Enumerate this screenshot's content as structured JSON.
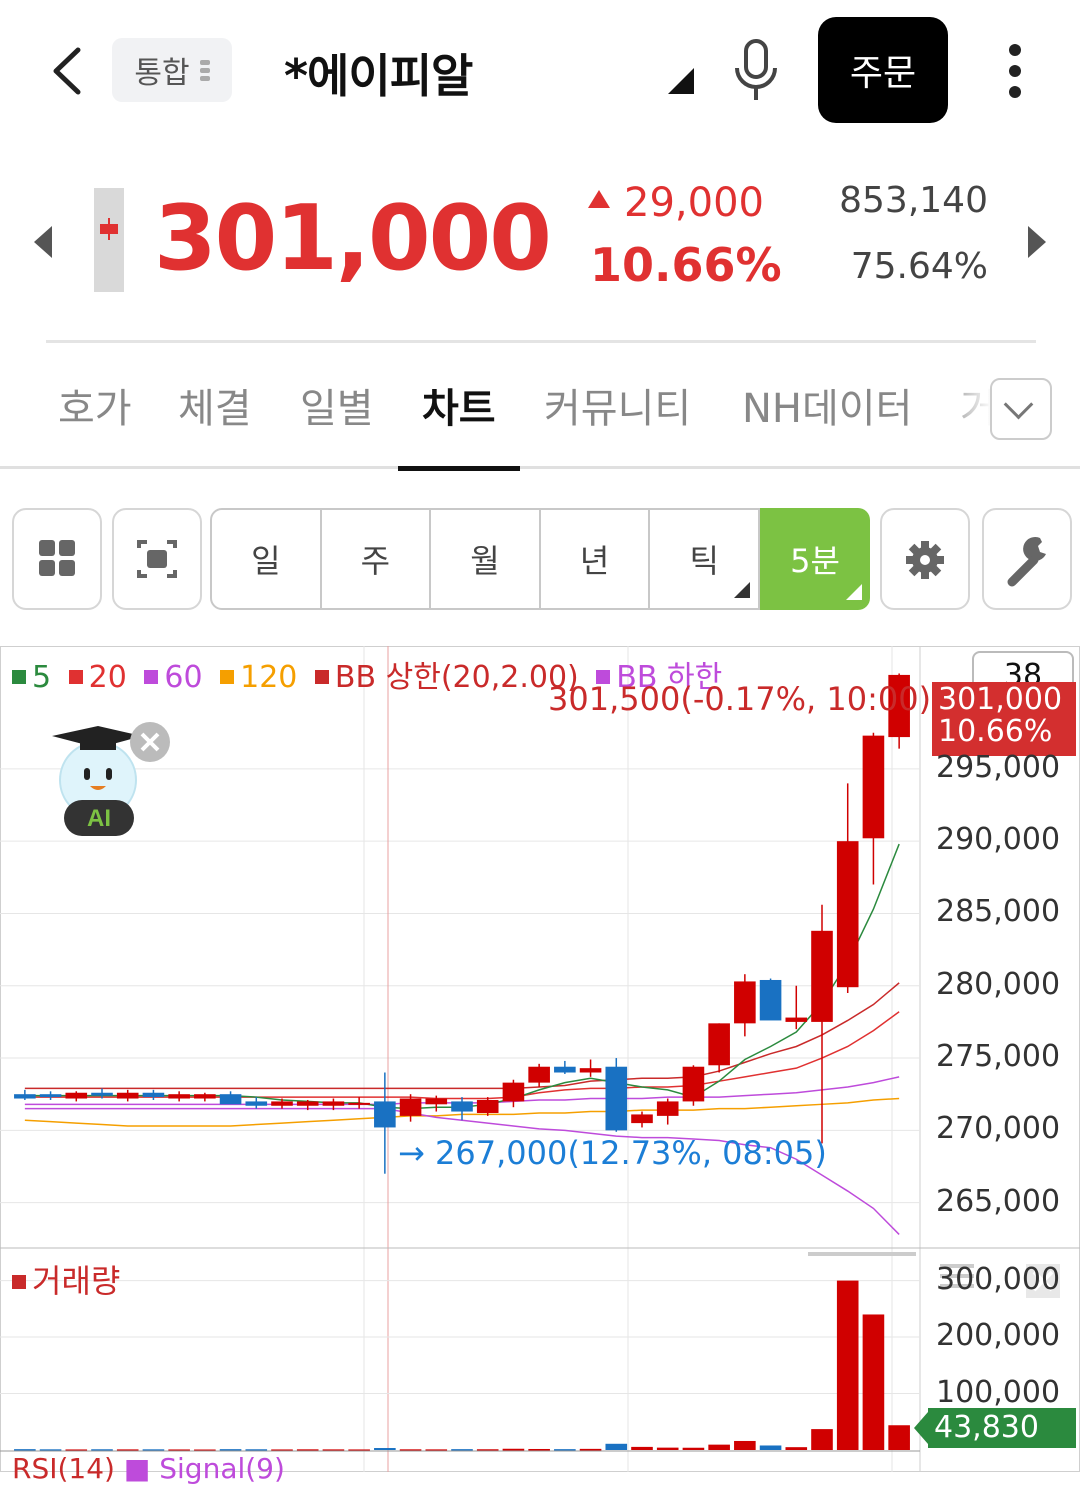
{
  "header": {
    "back_icon": "chevron-left-icon",
    "tag_label": "통합",
    "stock_name": "*에이피알",
    "mic_icon": "microphone-icon",
    "order_label": "주문",
    "more_icon": "kebab-menu-icon"
  },
  "quote": {
    "price": "301,000",
    "change": "29,000",
    "change_pct": "10.66%",
    "volume": "853,140",
    "volume_pct": "75.64%",
    "color_up": "#e03131"
  },
  "tabs": [
    {
      "label": "호가"
    },
    {
      "label": "체결"
    },
    {
      "label": "일별"
    },
    {
      "label": "차트"
    },
    {
      "label": "커뮤니티"
    },
    {
      "label": "NH데이터"
    },
    {
      "label": "거"
    }
  ],
  "active_tab": "차트",
  "toolbar": {
    "periods": [
      "일",
      "주",
      "월",
      "년",
      "틱"
    ],
    "active_period": "5분",
    "grid_icon": "grid-icon",
    "capture_icon": "capture-icon",
    "settings_icon": "gear-icon",
    "tools_icon": "wrench-icon",
    "accent": "#7cc243"
  },
  "chart": {
    "legend": [
      {
        "label": "5",
        "color": "#2b8a3e"
      },
      {
        "label": "20",
        "color": "#e03131"
      },
      {
        "label": "60",
        "color": "#be4bdb"
      },
      {
        "label": "120",
        "color": "#f59f00"
      },
      {
        "label": "BB 상한(20,2.00)",
        "color": "#c92a2a"
      },
      {
        "label": "BB 하한",
        "color": "#be4bdb"
      }
    ],
    "last_info": "301,500(-0.17%, 10:00)",
    "low_info": "267,000(12.73%, 08:05)",
    "count_badge": "38",
    "price_box": [
      "301,000",
      "10.66%"
    ],
    "y_ticks": [
      "295,000",
      "290,000",
      "285,000",
      "280,000",
      "275,000",
      "270,000",
      "265,000"
    ],
    "ai_label": "AI",
    "volume_legend": "거래량",
    "volume_ticks": [
      "300,000",
      "200,000",
      "100,000"
    ],
    "volume_box": "43,830",
    "rsi_label": "RSI(14)",
    "signal_label": "Signal(9)"
  },
  "chart_data": {
    "type": "candlestick",
    "interval": "5분",
    "ylim": [
      262000,
      303500
    ],
    "candles": [
      {
        "o": 272500,
        "h": 272800,
        "l": 272100,
        "c": 272200
      },
      {
        "o": 272500,
        "h": 272700,
        "l": 272100,
        "c": 272300
      },
      {
        "o": 272200,
        "h": 272700,
        "l": 272000,
        "c": 272600
      },
      {
        "o": 272600,
        "h": 272900,
        "l": 272200,
        "c": 272400
      },
      {
        "o": 272200,
        "h": 272800,
        "l": 272000,
        "c": 272600
      },
      {
        "o": 272600,
        "h": 272800,
        "l": 272100,
        "c": 272300
      },
      {
        "o": 272200,
        "h": 272700,
        "l": 272000,
        "c": 272500
      },
      {
        "o": 272200,
        "h": 272600,
        "l": 272000,
        "c": 272500
      },
      {
        "o": 272500,
        "h": 272700,
        "l": 271900,
        "c": 271800
      },
      {
        "o": 272000,
        "h": 272300,
        "l": 271500,
        "c": 271700
      },
      {
        "o": 271700,
        "h": 272200,
        "l": 271500,
        "c": 272000
      },
      {
        "o": 271700,
        "h": 272100,
        "l": 271400,
        "c": 272000
      },
      {
        "o": 271700,
        "h": 272200,
        "l": 271400,
        "c": 272000
      },
      {
        "o": 271800,
        "h": 272300,
        "l": 271500,
        "c": 271900
      },
      {
        "o": 272000,
        "h": 274000,
        "l": 267000,
        "c": 270200
      },
      {
        "o": 271000,
        "h": 272500,
        "l": 270600,
        "c": 272200
      },
      {
        "o": 271800,
        "h": 272400,
        "l": 271300,
        "c": 272200
      },
      {
        "o": 272000,
        "h": 272300,
        "l": 270700,
        "c": 271300
      },
      {
        "o": 271200,
        "h": 272300,
        "l": 271000,
        "c": 272100
      },
      {
        "o": 272000,
        "h": 273500,
        "l": 271600,
        "c": 273300
      },
      {
        "o": 273300,
        "h": 274600,
        "l": 273000,
        "c": 274400
      },
      {
        "o": 274400,
        "h": 274800,
        "l": 273900,
        "c": 274000
      },
      {
        "o": 274000,
        "h": 274900,
        "l": 273700,
        "c": 274300
      },
      {
        "o": 274400,
        "h": 275000,
        "l": 269900,
        "c": 270000
      },
      {
        "o": 270500,
        "h": 271300,
        "l": 270200,
        "c": 271100
      },
      {
        "o": 271000,
        "h": 272200,
        "l": 270400,
        "c": 272000
      },
      {
        "o": 272000,
        "h": 274500,
        "l": 271700,
        "c": 274400
      },
      {
        "o": 274500,
        "h": 277400,
        "l": 274000,
        "c": 277400
      },
      {
        "o": 277400,
        "h": 280800,
        "l": 276500,
        "c": 280300
      },
      {
        "o": 280400,
        "h": 280500,
        "l": 277700,
        "c": 277600
      },
      {
        "o": 277500,
        "h": 280000,
        "l": 277000,
        "c": 277800
      },
      {
        "o": 277500,
        "h": 285600,
        "l": 269100,
        "c": 283800
      },
      {
        "o": 279900,
        "h": 294000,
        "l": 279500,
        "c": 290000
      },
      {
        "o": 290200,
        "h": 297500,
        "l": 287000,
        "c": 297300
      },
      {
        "o": 297200,
        "h": 301600,
        "l": 296400,
        "c": 301500
      }
    ],
    "ma5": [
      272400,
      272400,
      272400,
      272400,
      272400,
      272400,
      272400,
      272400,
      272400,
      272300,
      272100,
      272000,
      271900,
      271900,
      271600,
      271500,
      271600,
      271600,
      271800,
      272200,
      272800,
      273300,
      273600,
      273300,
      273000,
      272800,
      272300,
      273400,
      274900,
      275800,
      276800,
      278800,
      281600,
      285300,
      289800
    ],
    "ma20": [
      272300,
      272300,
      272300,
      272300,
      272300,
      272300,
      272300,
      272300,
      272300,
      272300,
      272300,
      272300,
      272300,
      272300,
      272300,
      272300,
      272200,
      272200,
      272200,
      272300,
      272600,
      272800,
      272900,
      272900,
      273000,
      273000,
      273100,
      273400,
      273700,
      274000,
      274300,
      275000,
      275800,
      276900,
      278200
    ],
    "ma60": [
      271800,
      271800,
      271800,
      271800,
      271800,
      271800,
      271800,
      271800,
      271800,
      271800,
      271800,
      271800,
      271800,
      271800,
      271800,
      271900,
      271900,
      271900,
      271900,
      272000,
      272100,
      272100,
      272200,
      272200,
      272200,
      272300,
      272300,
      272300,
      272400,
      272500,
      272600,
      272800,
      273000,
      273300,
      273700
    ],
    "ma120": [
      270700,
      270600,
      270500,
      270400,
      270300,
      270300,
      270300,
      270300,
      270300,
      270400,
      270500,
      270600,
      270700,
      270800,
      270900,
      271000,
      271000,
      271100,
      271100,
      271100,
      271200,
      271200,
      271300,
      271300,
      271400,
      271400,
      271400,
      271500,
      271500,
      271600,
      271700,
      271800,
      271900,
      272100,
      272200
    ],
    "bb_upper": [
      272900,
      272900,
      272900,
      272900,
      272900,
      272900,
      272900,
      272900,
      272900,
      272900,
      272900,
      272900,
      272900,
      272900,
      272900,
      272900,
      272900,
      272900,
      272900,
      272900,
      273000,
      273100,
      273400,
      273500,
      273600,
      273600,
      273700,
      274100,
      274700,
      275300,
      275800,
      276600,
      277600,
      278700,
      280200
    ],
    "bb_lower": [
      271500,
      271500,
      271500,
      271500,
      271500,
      271500,
      271500,
      271500,
      271500,
      271500,
      271500,
      271500,
      271500,
      271500,
      271500,
      271200,
      270900,
      270700,
      270500,
      270300,
      270100,
      270000,
      269800,
      269600,
      269500,
      269500,
      269400,
      269300,
      269000,
      268800,
      268000,
      266900,
      265800,
      264600,
      262800
    ],
    "volume": [
      1500,
      1200,
      1000,
      1300,
      1100,
      1200,
      1000,
      900,
      1500,
      1300,
      1000,
      1200,
      1100,
      1000,
      3500,
      1200,
      1100,
      1500,
      1300,
      2200,
      1800,
      1500,
      2000,
      11000,
      5500,
      4200,
      4000,
      9500,
      16000,
      8000,
      5000,
      37000,
      300000,
      240000,
      43830
    ],
    "volume_ylim": [
      0,
      340000
    ]
  }
}
